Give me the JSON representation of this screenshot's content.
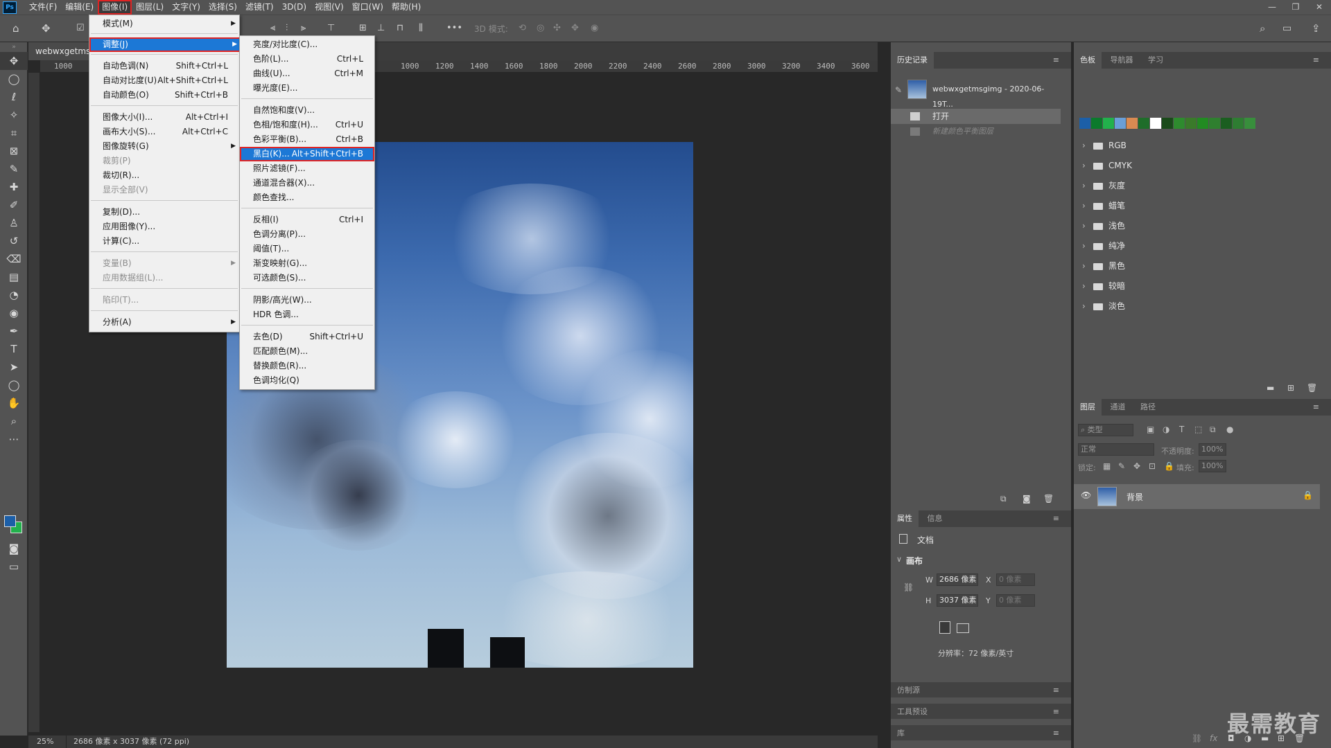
{
  "menubar": {
    "logo": "Ps",
    "items": [
      "文件(F)",
      "编辑(E)",
      "图像(I)",
      "图层(L)",
      "文字(Y)",
      "选择(S)",
      "滤镜(T)",
      "3D(D)",
      "视图(V)",
      "窗口(W)",
      "帮助(H)"
    ],
    "window_controls": [
      "—",
      "❐",
      "✕"
    ]
  },
  "optionsbar": {
    "label_3d": "3D 模式:",
    "more": "•••"
  },
  "document": {
    "tab": "webwxgetmsgimg",
    "ruler_marks": [
      "1000",
      "1000",
      "1200",
      "1400",
      "1600",
      "1800",
      "2000",
      "2200",
      "2400",
      "2600",
      "2800",
      "3000",
      "3200",
      "3400",
      "3600"
    ],
    "zoom": "25%",
    "info": "2686 像素 x 3037 像素 (72 ppi)"
  },
  "image_menu": {
    "items": [
      {
        "label": "模式(M)",
        "sc": "",
        "sub": true,
        "dis": false
      },
      {
        "label": "调整(J)",
        "sc": "",
        "sub": true,
        "dis": false,
        "hl": true
      },
      {
        "label": "自动色调(N)",
        "sc": "Shift+Ctrl+L"
      },
      {
        "label": "自动对比度(U)",
        "sc": "Alt+Shift+Ctrl+L"
      },
      {
        "label": "自动颜色(O)",
        "sc": "Shift+Ctrl+B"
      },
      {
        "label": "图像大小(I)...",
        "sc": "Alt+Ctrl+I"
      },
      {
        "label": "画布大小(S)...",
        "sc": "Alt+Ctrl+C"
      },
      {
        "label": "图像旋转(G)",
        "sc": "",
        "sub": true
      },
      {
        "label": "裁剪(P)",
        "sc": "",
        "dis": true
      },
      {
        "label": "裁切(R)...",
        "sc": ""
      },
      {
        "label": "显示全部(V)",
        "sc": "",
        "dis": true
      },
      {
        "label": "复制(D)...",
        "sc": ""
      },
      {
        "label": "应用图像(Y)...",
        "sc": ""
      },
      {
        "label": "计算(C)...",
        "sc": ""
      },
      {
        "label": "变量(B)",
        "sc": "",
        "sub": true,
        "dis": true
      },
      {
        "label": "应用数据组(L)...",
        "sc": "",
        "dis": true
      },
      {
        "label": "陷印(T)...",
        "sc": "",
        "dis": true
      },
      {
        "label": "分析(A)",
        "sc": "",
        "sub": true
      }
    ]
  },
  "adjust_menu": {
    "items": [
      {
        "label": "亮度/对比度(C)...",
        "sc": ""
      },
      {
        "label": "色阶(L)...",
        "sc": "Ctrl+L"
      },
      {
        "label": "曲线(U)...",
        "sc": "Ctrl+M"
      },
      {
        "label": "曝光度(E)...",
        "sc": ""
      },
      {
        "label": "自然饱和度(V)...",
        "sc": ""
      },
      {
        "label": "色相/饱和度(H)...",
        "sc": "Ctrl+U"
      },
      {
        "label": "色彩平衡(B)...",
        "sc": "Ctrl+B"
      },
      {
        "label": "黑白(K)...",
        "sc": "Alt+Shift+Ctrl+B",
        "hl": true
      },
      {
        "label": "照片滤镜(F)...",
        "sc": ""
      },
      {
        "label": "通道混合器(X)...",
        "sc": ""
      },
      {
        "label": "颜色查找...",
        "sc": ""
      },
      {
        "label": "反相(I)",
        "sc": "Ctrl+I"
      },
      {
        "label": "色调分离(P)...",
        "sc": ""
      },
      {
        "label": "阈值(T)...",
        "sc": ""
      },
      {
        "label": "渐变映射(G)...",
        "sc": ""
      },
      {
        "label": "可选颜色(S)...",
        "sc": ""
      },
      {
        "label": "阴影/高光(W)...",
        "sc": ""
      },
      {
        "label": "HDR 色调...",
        "sc": ""
      },
      {
        "label": "去色(D)",
        "sc": "Shift+Ctrl+U"
      },
      {
        "label": "匹配颜色(M)...",
        "sc": ""
      },
      {
        "label": "替换颜色(R)...",
        "sc": ""
      },
      {
        "label": "色调均化(Q)",
        "sc": ""
      }
    ]
  },
  "history": {
    "tab": "历史记录",
    "snapshot": "webwxgetmsgimg - 2020-06-19T...",
    "rows": [
      "打开",
      "新建颜色平衡图层"
    ]
  },
  "properties": {
    "tabs": [
      "属性",
      "信息"
    ],
    "doc_label": "文档",
    "section": "画布",
    "w_label": "W",
    "w_value": "2686 像素",
    "h_label": "H",
    "h_value": "3037 像素",
    "x_label": "X",
    "x_value": "0 像素",
    "y_label": "Y",
    "y_value": "0 像素",
    "resolution": "分辨率：72 像素/英寸"
  },
  "collapsed_panels": [
    "仿制源",
    "工具预设",
    "库"
  ],
  "swatches": {
    "tabs": [
      "色板",
      "导航器",
      "学习"
    ],
    "colors": [
      "#1c5fa8",
      "#0b7a2c",
      "#22b14c",
      "#6a9fd8",
      "#d98a52",
      "#1f6d2a",
      "#ffffff",
      "#1a4a1a",
      "#2e8b2e",
      "#3a7a2a",
      "#228b22",
      "#2f7f2f",
      "#1b5e20",
      "#2e7d32",
      "#388e3c"
    ],
    "groups": [
      "RGB",
      "CMYK",
      "灰度",
      "蜡笔",
      "浅色",
      "纯净",
      "黑色",
      "较暗",
      "淡色"
    ]
  },
  "layers": {
    "tabs": [
      "图层",
      "通道",
      "路径"
    ],
    "filter_placeholder": "类型",
    "blend_mode": "正常",
    "opacity_label": "不透明度:",
    "opacity_value": "100%",
    "lock_label": "锁定:",
    "fill_label": "填充:",
    "fill_value": "100%",
    "layer_name": "背景"
  },
  "watermark": "最需教育"
}
